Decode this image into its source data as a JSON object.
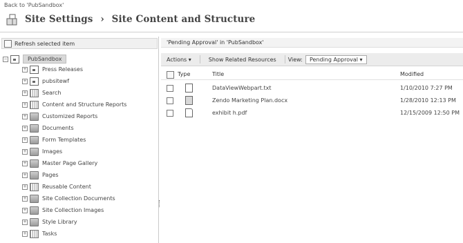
{
  "header": {
    "back_link": "Back to 'PubSandbox'",
    "title_part1": "Site Settings",
    "separator": "›",
    "title_part2": "Site Content and Structure"
  },
  "left": {
    "refresh_label": "Refresh selected item",
    "root_label": "PubSandbox",
    "tree": [
      {
        "label": "Press Releases",
        "icon": "site-icon"
      },
      {
        "label": "pubsitewf",
        "icon": "site-icon"
      },
      {
        "label": "Search",
        "icon": "search-site-icon"
      },
      {
        "label": "Content and Structure Reports",
        "icon": "list-icon"
      },
      {
        "label": "Customized Reports",
        "icon": "library-icon"
      },
      {
        "label": "Documents",
        "icon": "library-icon"
      },
      {
        "label": "Form Templates",
        "icon": "library-icon"
      },
      {
        "label": "Images",
        "icon": "image-library-icon"
      },
      {
        "label": "Master Page Gallery",
        "icon": "library-icon"
      },
      {
        "label": "Pages",
        "icon": "library-icon"
      },
      {
        "label": "Reusable Content",
        "icon": "list-icon"
      },
      {
        "label": "Site Collection Documents",
        "icon": "library-icon"
      },
      {
        "label": "Site Collection Images",
        "icon": "library-icon"
      },
      {
        "label": "Style Library",
        "icon": "library-icon"
      },
      {
        "label": "Tasks",
        "icon": "tasks-icon"
      }
    ]
  },
  "right": {
    "context_title": "'Pending Approval' in 'PubSandbox'",
    "toolbar": {
      "actions_label": "Actions",
      "show_related_label": "Show Related Resources",
      "view_label": "View:",
      "view_value": "Pending Approval"
    },
    "columns": {
      "type": "Type",
      "title": "Title",
      "modified": "Modified"
    },
    "rows": [
      {
        "title": "DataViewWebpart.txt",
        "modified": "1/10/2010 7:27 PM",
        "icon": "text-file-icon"
      },
      {
        "title": "Zendo Marketing Plan.docx",
        "modified": "1/28/2010 12:13 PM",
        "icon": "word-file-icon"
      },
      {
        "title": "exhibit h.pdf",
        "modified": "12/15/2009 12:50 PM",
        "icon": "pdf-file-icon"
      }
    ]
  }
}
